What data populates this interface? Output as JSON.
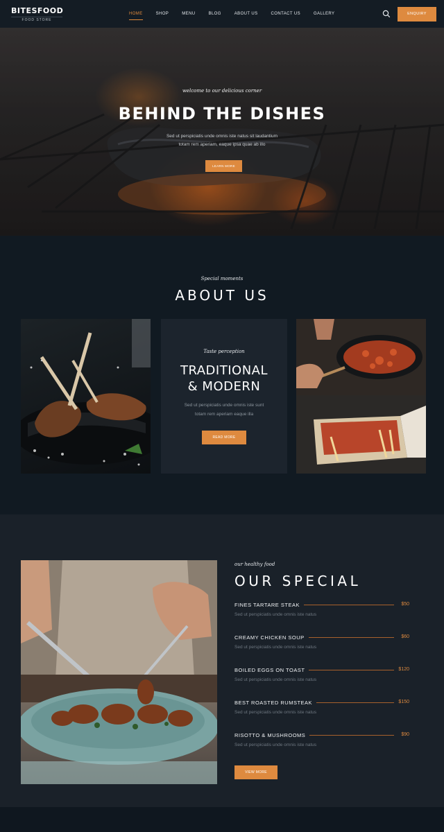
{
  "brand": {
    "name": "BITESFOOD",
    "sub": "FOOD STORE"
  },
  "nav": {
    "items": [
      "HOME",
      "SHOP",
      "MENU",
      "BLOG",
      "ABOUT US",
      "CONTACT US",
      "GALLERY"
    ],
    "enquiry": "ENQUIRY",
    "accent": "#de8a3f"
  },
  "hero": {
    "tagline": "welcome to our delicious corner",
    "title": "BEHIND THE DISHES",
    "text_line1": "Sed ut perspiciatis unde omnis iste natus sit laudantium",
    "text_line2": "totam rem aperiam, eaque ipsa quae ab illo",
    "button": "LEARN MORE"
  },
  "about": {
    "tagline": "Special moments",
    "title": "ABOUT US",
    "card": {
      "tagline": "Taste perception",
      "title_line1": "TRADITIONAL",
      "title_line2": "& MODERN",
      "text_line1": "Sed ut perspiciatis unde omnis iste sunt",
      "text_line2": "totam rem aperiam eaque illa",
      "button": "READ MORE"
    }
  },
  "special": {
    "tagline": "our healthy food",
    "title": "OUR SPECIAL",
    "items": [
      {
        "name": "FINES TARTARE STEAK",
        "price": "$50",
        "desc": "Sed ut perspiciatis unde omnis iste natus"
      },
      {
        "name": "CREAMY CHICKEN SOUP",
        "price": "$60",
        "desc": "Sed ut perspiciatis unde omnis iste natus"
      },
      {
        "name": "BOILED EGGS ON TOAST",
        "price": "$120",
        "desc": "Sed ut perspiciatis unde omnis iste natus"
      },
      {
        "name": "BEST ROASTED RUMSTEAK",
        "price": "$150",
        "desc": "Sed ut perspiciatis unde omnis iste natus"
      },
      {
        "name": "RISOTTO & MUSHROOMS",
        "price": "$90",
        "desc": "Sed ut perspiciatis unde omnis iste natus"
      }
    ],
    "button": "VIEW MORE"
  }
}
